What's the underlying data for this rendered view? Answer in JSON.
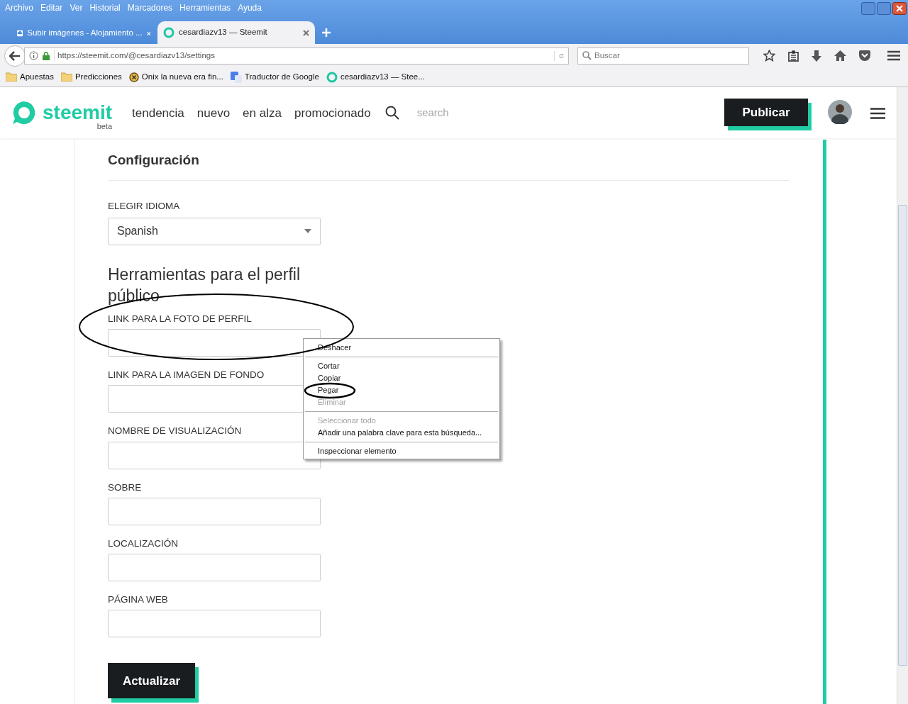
{
  "menu_bar": [
    "Archivo",
    "Editar",
    "Ver",
    "Historial",
    "Marcadores",
    "Herramientas",
    "Ayuda"
  ],
  "tabs": [
    {
      "title": "Subir imágenes - Alojamiento ...",
      "selected": false
    },
    {
      "title": "cesardiazv13 — Steemit",
      "selected": true
    }
  ],
  "address_bar": {
    "url": "https://steemit.com/@cesardiazv13/settings"
  },
  "search_bar": {
    "placeholder": "Buscar"
  },
  "bookmarks": [
    {
      "label": "Apuestas",
      "kind": "folder"
    },
    {
      "label": "Predicciones",
      "kind": "folder"
    },
    {
      "label": "Onix la nueva era fin...",
      "kind": "coin"
    },
    {
      "label": "Traductor de Google",
      "kind": "translate"
    },
    {
      "label": "cesardiazv13 — Stee...",
      "kind": "steemit"
    }
  ],
  "site_header": {
    "logo": "steemit",
    "badge": "beta",
    "nav": [
      "tendencia",
      "nuevo",
      "en alza",
      "promocionado"
    ],
    "search_placeholder": "search",
    "publish": "Publicar"
  },
  "settings": {
    "title": "Configuración",
    "language_label": "ELEGIR IDIOMA",
    "language_value": "Spanish",
    "profile_heading": "Herramientas para el perfil público",
    "fields": [
      {
        "label": "LINK PARA LA FOTO DE PERFIL"
      },
      {
        "label": "LINK PARA LA IMAGEN DE FONDO"
      },
      {
        "label": "NOMBRE DE VISUALIZACIÓN"
      },
      {
        "label": "SOBRE"
      },
      {
        "label": "LOCALIZACIÓN"
      },
      {
        "label": "PÁGINA WEB"
      }
    ],
    "submit": "Actualizar"
  },
  "context_menu": [
    {
      "kind": "item",
      "label": "Deshacer",
      "disabled": false
    },
    {
      "kind": "separator"
    },
    {
      "kind": "item",
      "label": "Cortar",
      "disabled": false
    },
    {
      "kind": "item",
      "label": "Copiar",
      "disabled": false
    },
    {
      "kind": "item",
      "label": "Pegar",
      "disabled": false
    },
    {
      "kind": "item",
      "label": "Eliminar",
      "disabled": true
    },
    {
      "kind": "separator"
    },
    {
      "kind": "item",
      "label": "Seleccionar todo",
      "disabled": true
    },
    {
      "kind": "item",
      "label": "Añadir una palabra clave para esta búsqueda...",
      "disabled": false
    },
    {
      "kind": "separator"
    },
    {
      "kind": "item",
      "label": "Inspeccionar elemento",
      "disabled": false
    }
  ]
}
